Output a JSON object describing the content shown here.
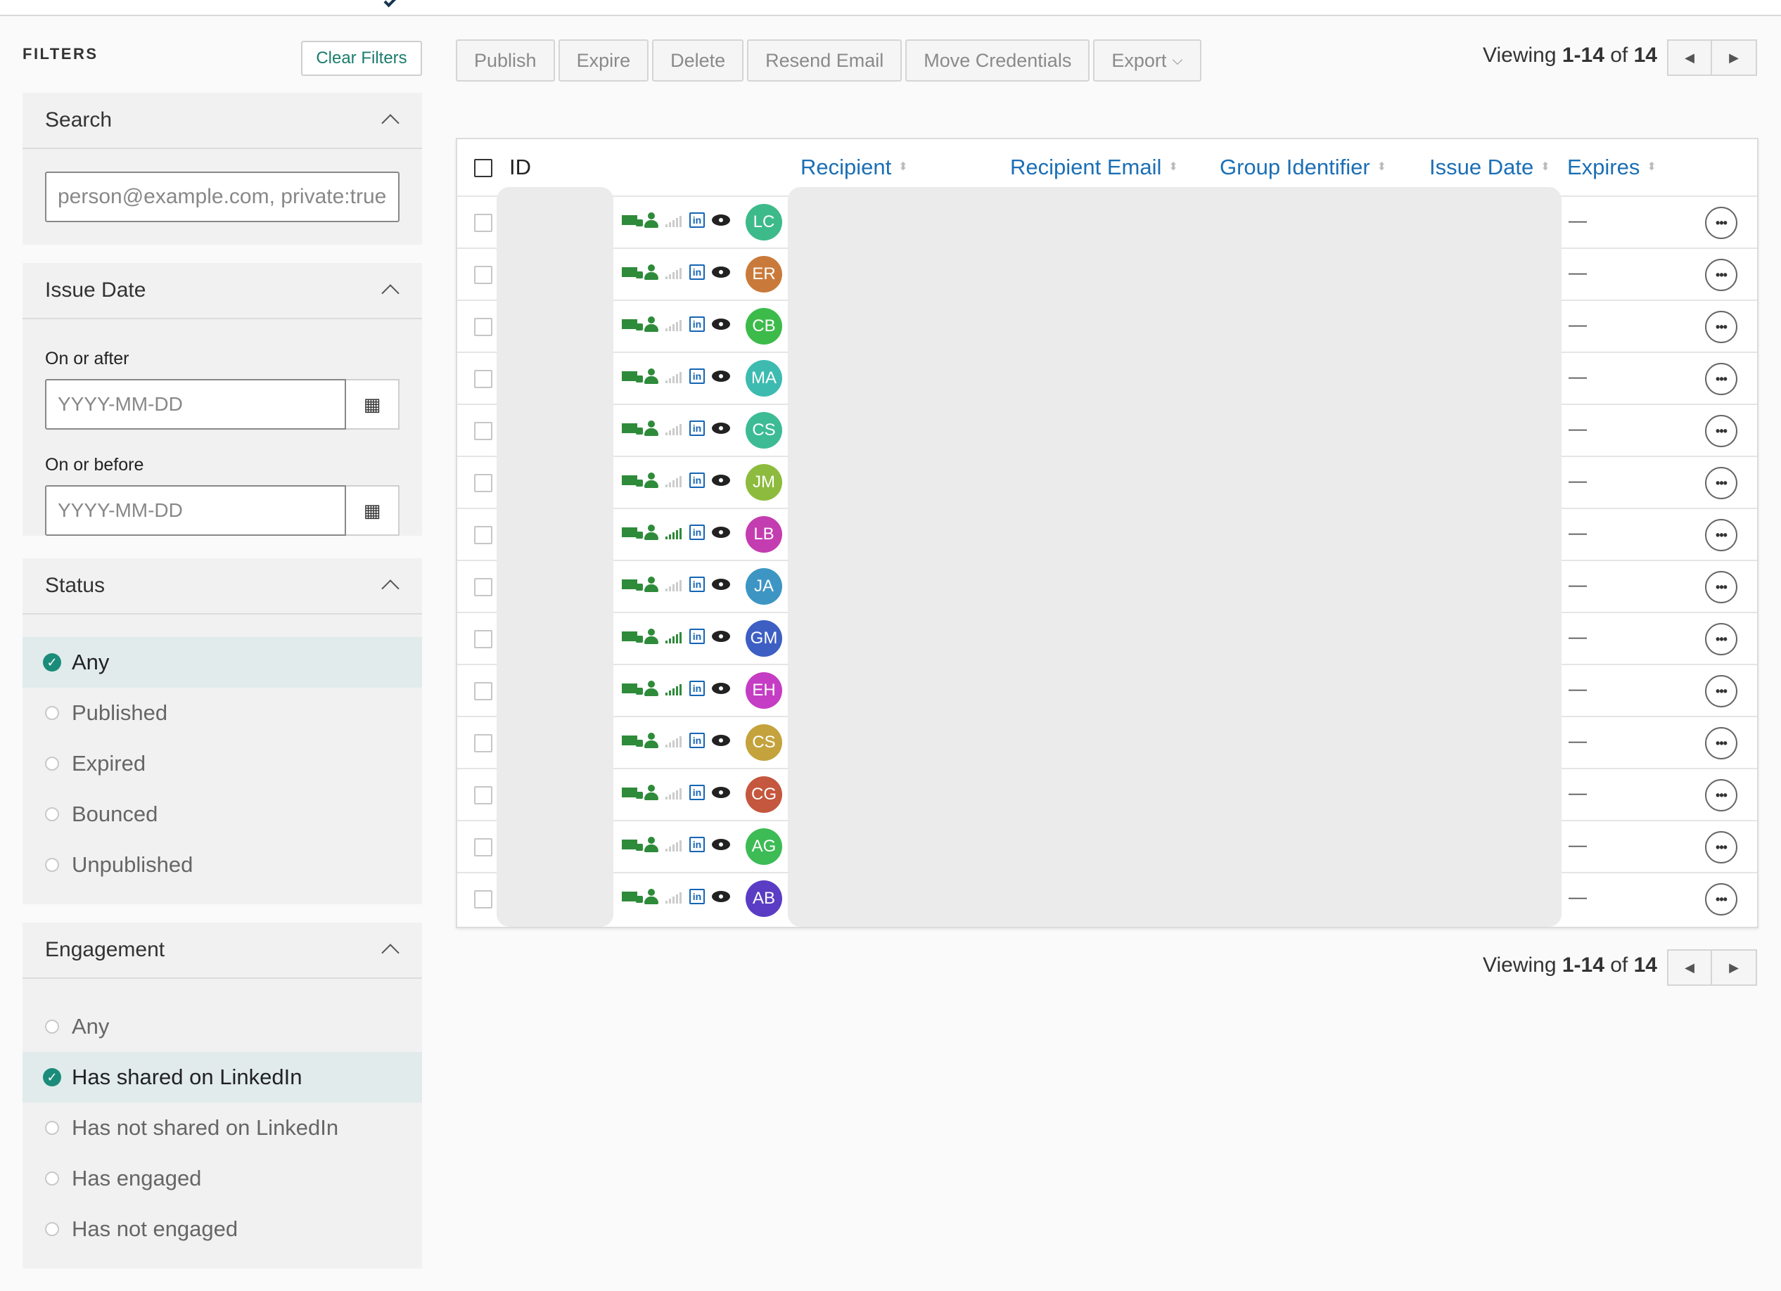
{
  "sidebar": {
    "filters_title": "FILTERS",
    "clear_label": "Clear Filters",
    "search": {
      "title": "Search",
      "placeholder": "person@example.com, private:true"
    },
    "issue_date": {
      "title": "Issue Date",
      "after_label": "On or after",
      "before_label": "On or before",
      "date_placeholder": "YYYY-MM-DD"
    },
    "status": {
      "title": "Status",
      "options": [
        {
          "label": "Any",
          "selected": true
        },
        {
          "label": "Published",
          "selected": false
        },
        {
          "label": "Expired",
          "selected": false
        },
        {
          "label": "Bounced",
          "selected": false
        },
        {
          "label": "Unpublished",
          "selected": false
        }
      ]
    },
    "engagement": {
      "title": "Engagement",
      "options": [
        {
          "label": "Any",
          "selected": false
        },
        {
          "label": "Has shared on LinkedIn",
          "selected": true
        },
        {
          "label": "Has not shared on LinkedIn",
          "selected": false
        },
        {
          "label": "Has engaged",
          "selected": false
        },
        {
          "label": "Has not engaged",
          "selected": false
        }
      ]
    }
  },
  "toolbar": {
    "publish": "Publish",
    "expire": "Expire",
    "delete": "Delete",
    "resend": "Resend Email",
    "move": "Move Credentials",
    "export": "Export"
  },
  "pagination": {
    "prefix": "Viewing ",
    "range": "1-14",
    "of": " of ",
    "total": "14"
  },
  "table": {
    "columns": {
      "id": "ID",
      "recipient": "Recipient",
      "email": "Recipient Email",
      "group": "Group Identifier",
      "issue_date": "Issue Date",
      "expires": "Expires"
    },
    "rows": [
      {
        "initials": "LC",
        "color": "#3dba8a",
        "signal": false,
        "expires": "—"
      },
      {
        "initials": "ER",
        "color": "#c97a3a",
        "signal": false,
        "expires": "—"
      },
      {
        "initials": "CB",
        "color": "#3dbb4a",
        "signal": false,
        "expires": "—"
      },
      {
        "initials": "MA",
        "color": "#3dbbb0",
        "signal": false,
        "expires": "—"
      },
      {
        "initials": "CS",
        "color": "#3dbb95",
        "signal": false,
        "expires": "—"
      },
      {
        "initials": "JM",
        "color": "#8dbb3d",
        "signal": false,
        "expires": "—"
      },
      {
        "initials": "LB",
        "color": "#c43db0",
        "signal": true,
        "expires": "—"
      },
      {
        "initials": "JA",
        "color": "#3d95c4",
        "signal": false,
        "expires": "—"
      },
      {
        "initials": "GM",
        "color": "#3d5fc4",
        "signal": true,
        "expires": "—"
      },
      {
        "initials": "EH",
        "color": "#c43dc4",
        "signal": true,
        "expires": "—"
      },
      {
        "initials": "CS",
        "color": "#c4a33d",
        "signal": false,
        "expires": "—"
      },
      {
        "initials": "CG",
        "color": "#c4573d",
        "signal": false,
        "expires": "—"
      },
      {
        "initials": "AG",
        "color": "#3dbb55",
        "signal": false,
        "expires": "—"
      },
      {
        "initials": "AB",
        "color": "#5a3dc4",
        "signal": false,
        "expires": "—"
      }
    ]
  }
}
